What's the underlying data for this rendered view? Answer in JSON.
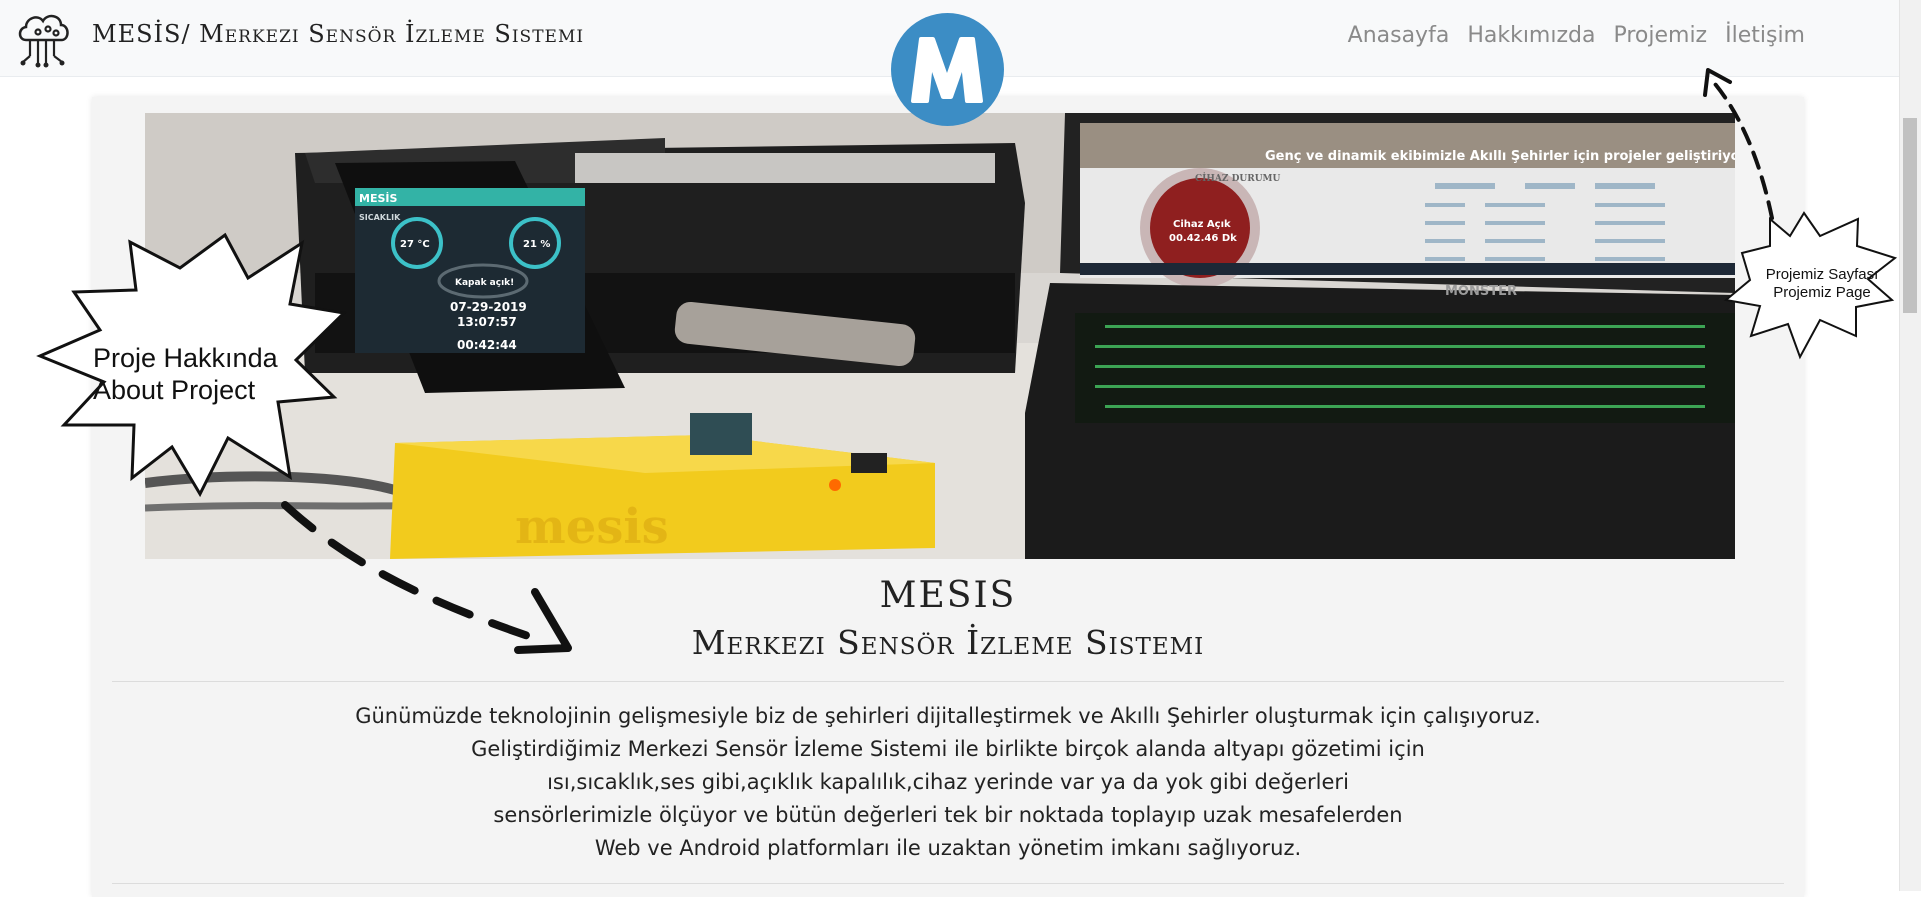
{
  "navbar": {
    "brand": "MESİS/ Merkezi Sensör İzleme Sistemi",
    "brand_icon": "cloud-circuit-icon",
    "logo_letter": "M",
    "logo_color": "#3c8dc5",
    "links": [
      {
        "label": "Anasayfa"
      },
      {
        "label": "Hakkımızda"
      },
      {
        "label": "Projemiz"
      },
      {
        "label": "İletişim"
      }
    ]
  },
  "hero": {
    "phone": {
      "app_title": "MESİS",
      "section": "SICAKLIK",
      "temperature": "27 °C",
      "humidity": "21 %",
      "lid_status": "Kapak açık!",
      "date": "07-29-2019",
      "time": "13:07:57",
      "elapsed": "00:42:44"
    },
    "laptop": {
      "banner": "Genç ve dinamik ekibimizle Akıllı Şehirler için projeler geliştiriyoruz",
      "panel_title": "CİHAZ DURUMU",
      "device_state": "Cihaz Açık",
      "device_time": "00.42.46 Dk",
      "brand": "MONSTER"
    },
    "device_label": "mesis"
  },
  "heading": {
    "title": "MESIS",
    "subtitle": "Merkezi Sensör İzleme Sistemi"
  },
  "description": {
    "lines": [
      "Günümüzde teknolojinin gelişmesiyle biz de şehirleri dijitalleştirmek ve Akıllı Şehirler oluşturmak için çalışıyoruz.",
      "Geliştirdiğimiz Merkezi Sensör İzleme Sistemi ile birlikte birçok alanda altyapı gözetimi için",
      "ısı,sıcaklık,ses gibi,açıklık kapalılık,cihaz yerinde var ya da yok gibi değerleri",
      "sensörlerimizle ölçüyor ve bütün değerleri tek bir noktada toplayıp uzak mesafelerden",
      "Web ve Android platformları ile uzaktan yönetim imkanı sağlıyoruz."
    ]
  },
  "annotations": {
    "left_line1": "Proje Hakkında",
    "left_line2": "About Project",
    "right_line1": "Projemiz Sayfası",
    "right_line2": "Projemiz Page"
  }
}
